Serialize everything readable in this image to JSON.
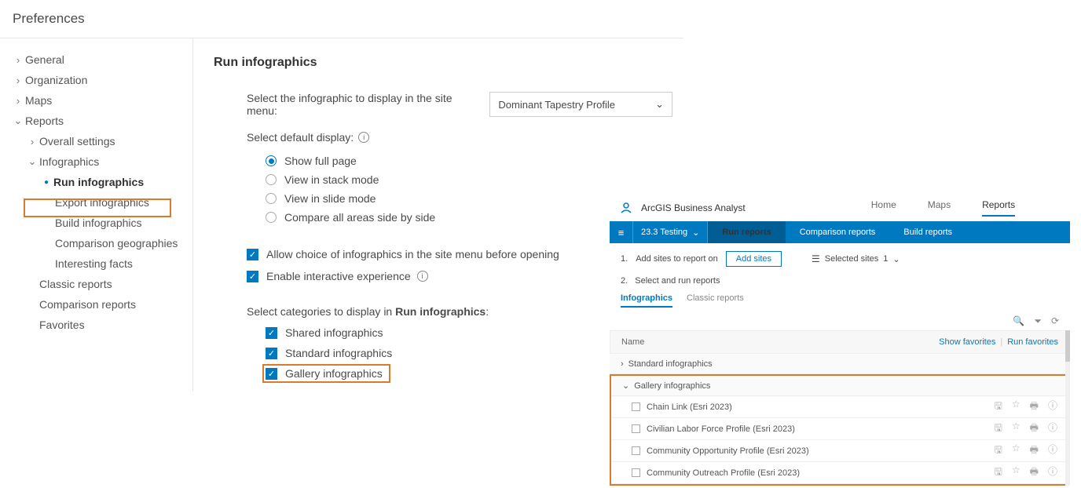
{
  "title": "Preferences",
  "nav": {
    "general": "General",
    "organization": "Organization",
    "maps": "Maps",
    "reports": "Reports",
    "overall": "Overall settings",
    "infographics": "Infographics",
    "run": "Run infographics",
    "export": "Export infographics",
    "build": "Build infographics",
    "compgeo": "Comparison geographies",
    "facts": "Interesting facts",
    "classic": "Classic reports",
    "compreports": "Comparison reports",
    "favorites": "Favorites"
  },
  "main": {
    "heading": "Run infographics",
    "select_label": "Select the infographic to display in the site menu:",
    "select_value": "Dominant Tapestry Profile",
    "default_display_label": "Select default display:",
    "radios": {
      "full": "Show full page",
      "stack": "View in stack mode",
      "slide": "View in slide mode",
      "compare": "Compare all areas side by side"
    },
    "allow_choice": "Allow choice of infographics in the site menu before opening",
    "enable_interactive": "Enable interactive experience",
    "categories_prefix": "Select categories to display in ",
    "categories_bold": "Run infographics",
    "categories_suffix": ":",
    "cats": {
      "shared": "Shared infographics",
      "standard": "Standard infographics",
      "gallery": "Gallery infographics"
    }
  },
  "app": {
    "name": "ArcGIS Business Analyst",
    "tabs": {
      "home": "Home",
      "maps": "Maps",
      "reports": "Reports"
    },
    "project": "23.3 Testing",
    "bb": {
      "run": "Run reports",
      "comp": "Comparison reports",
      "build": "Build reports"
    },
    "step1_num": "1.",
    "step1": "Add sites to report on",
    "add_sites": "Add sites",
    "selected_sites": "Selected sites",
    "selected_count": "1",
    "step2_num": "2.",
    "step2": "Select and run reports",
    "subtabs": {
      "infographics": "Infographics",
      "classic": "Classic reports"
    },
    "name_col": "Name",
    "show_fav": "Show favorites",
    "sep": "|",
    "run_fav": "Run favorites",
    "groups": {
      "standard": "Standard infographics",
      "gallery": "Gallery infographics"
    },
    "items": [
      "Chain Link (Esri 2023)",
      "Civilian Labor Force Profile (Esri 2023)",
      "Community Opportunity Profile (Esri 2023)",
      "Community Outreach Profile (Esri 2023)"
    ]
  }
}
